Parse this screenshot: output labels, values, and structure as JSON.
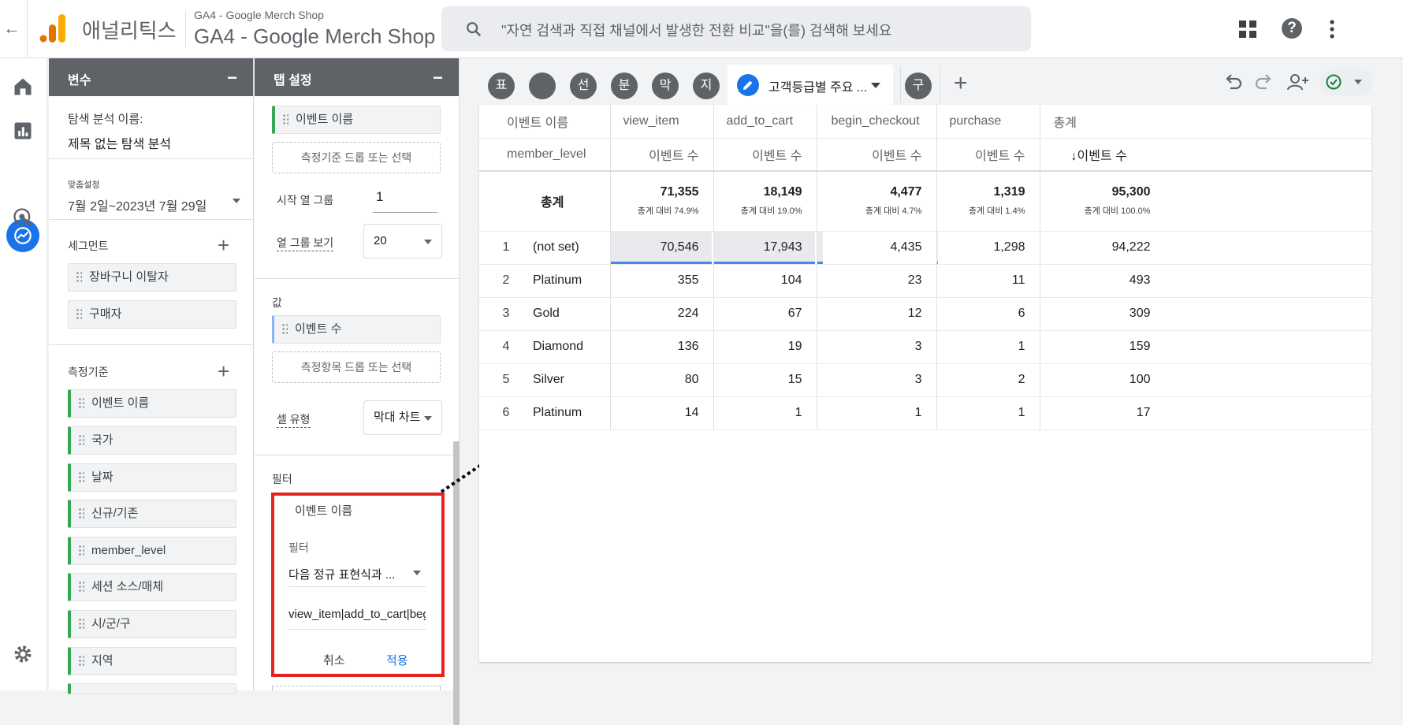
{
  "header": {
    "app_name": "애널리틱스",
    "property_small": "GA4 - Google Merch Shop",
    "property_big": "GA4 - Google Merch Shop",
    "search_placeholder": "\"자연 검색과 직접 채널에서 발생한 전환 비교\"을(를) 검색해 보세요"
  },
  "variables": {
    "title": "변수",
    "exploration_label": "탐색 분석 이름:",
    "exploration_name": "제목 없는 탐색 분석",
    "date_badge": "맞춤설정",
    "date_range": "7월 2일~2023년 7월 29일",
    "segments_title": "세그먼트",
    "segments": [
      "장바구니 이탈자",
      "구매자"
    ],
    "dimensions_title": "측정기준",
    "dimensions": [
      "이벤트 이름",
      "국가",
      "날짜",
      "신규/기존",
      "member_level",
      "세션 소스/매체",
      "시/군/구",
      "지역"
    ]
  },
  "tab_settings": {
    "title": "탭 설정",
    "column_chip": "이벤트 이름",
    "dimension_drop": "측정기준 드롭 또는 선택",
    "start_col_group_label": "시작 열 그룹",
    "start_col_group_value": "1",
    "show_col_groups_label": "열 그룹 보기",
    "show_col_groups_value": "20",
    "values_label": "값",
    "values_chip": "이벤트 수",
    "metric_drop": "측정항목 드롭 또는 선택",
    "cell_type_label": "셀 유형",
    "cell_type_value": "막대 차트",
    "filters_label": "필터",
    "filter_chip": "이벤트 이름",
    "filter_sub_label": "필터",
    "filter_match": "다음 정규 표현식과 ...",
    "filter_expression": "view_item|add_to_cart|begin_checkout|purchase",
    "cancel": "취소",
    "apply": "적용"
  },
  "tabs": {
    "icons": [
      "표",
      "●",
      "선",
      "분",
      "막",
      "지"
    ],
    "active_name": "고객등급별 주요 ...",
    "extra": "구",
    "add": "+"
  },
  "table": {
    "row_dim_header": "이벤트 이름",
    "row_dim_sub": "member_level",
    "columns": [
      "view_item",
      "add_to_cart",
      "begin_checkout",
      "purchase",
      "총계"
    ],
    "metric_label": "이벤트 수",
    "total_metric_label": "↓이벤트 수",
    "totals_label": "총계",
    "totals": [
      {
        "value": "71,355",
        "pct": "총계 대비 74.9%"
      },
      {
        "value": "18,149",
        "pct": "총계 대비 19.0%"
      },
      {
        "value": "4,477",
        "pct": "총계 대비 4.7%"
      },
      {
        "value": "1,319",
        "pct": "총계 대비 1.4%"
      },
      {
        "value": "95,300",
        "pct": "총계 대비 100.0%"
      }
    ],
    "rows": [
      {
        "idx": "1",
        "level": "(not set)",
        "vals": [
          "70,546",
          "17,943",
          "4,435",
          "1,298",
          "94,222"
        ]
      },
      {
        "idx": "2",
        "level": "Platinum",
        "vals": [
          "355",
          "104",
          "23",
          "11",
          "493"
        ]
      },
      {
        "idx": "3",
        "level": "Gold",
        "vals": [
          "224",
          "67",
          "12",
          "6",
          "309"
        ]
      },
      {
        "idx": "4",
        "level": "Diamond",
        "vals": [
          "136",
          "19",
          "3",
          "1",
          "159"
        ]
      },
      {
        "idx": "5",
        "level": "Silver",
        "vals": [
          "80",
          "15",
          "3",
          "2",
          "100"
        ]
      },
      {
        "idx": "6",
        "level": "Platinum",
        "vals": [
          "14",
          "1",
          "1",
          "1",
          "17"
        ]
      }
    ],
    "row1_bar_fill": [
      0.99,
      0.99,
      0.05,
      0.01
    ]
  },
  "colors": {
    "accent": "#1a73e8",
    "dimension_chip_bar": "#34a853",
    "highlight": "#e52420",
    "panel_header": "#5f6368"
  }
}
